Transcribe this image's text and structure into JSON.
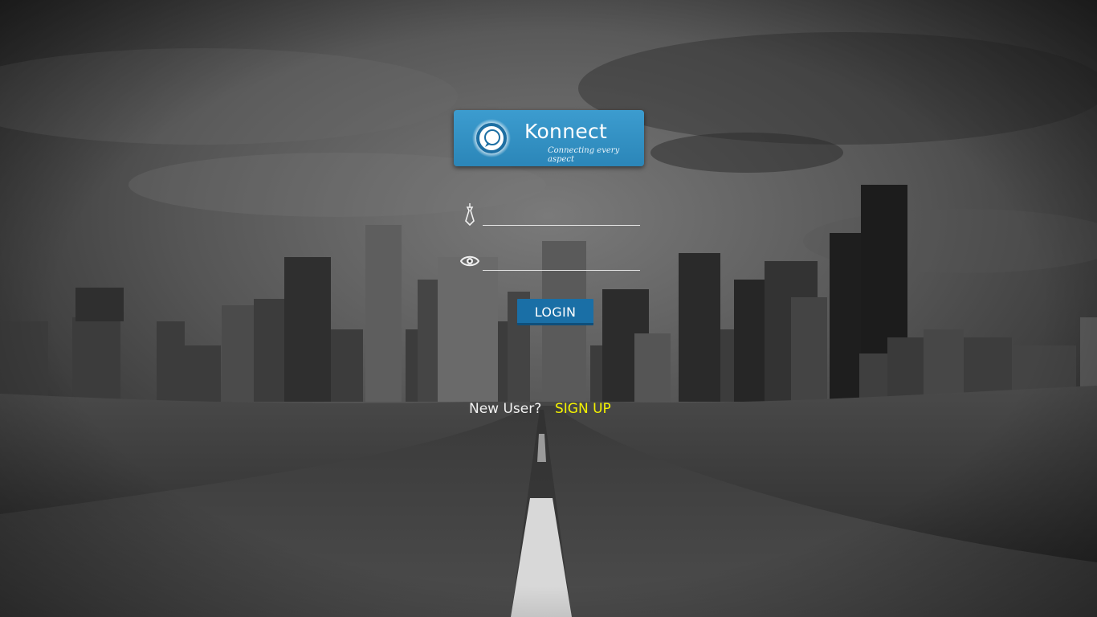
{
  "brand": {
    "name": "Konnect",
    "tagline": "Connecting every aspect",
    "logo_icon": "chat-bubble-logo-icon",
    "card_color": "#3197c9"
  },
  "login_form": {
    "username_icon": "tie-user-icon",
    "username_value": "",
    "password_icon": "eye-icon",
    "password_value": "",
    "login_label": "LOGIN",
    "login_color": "#1a6fa6"
  },
  "signup_prompt": {
    "question": "New User?",
    "link_label": "SIGN UP",
    "link_color": "#f4f200"
  },
  "background": {
    "description_icon": "city-road-background"
  }
}
